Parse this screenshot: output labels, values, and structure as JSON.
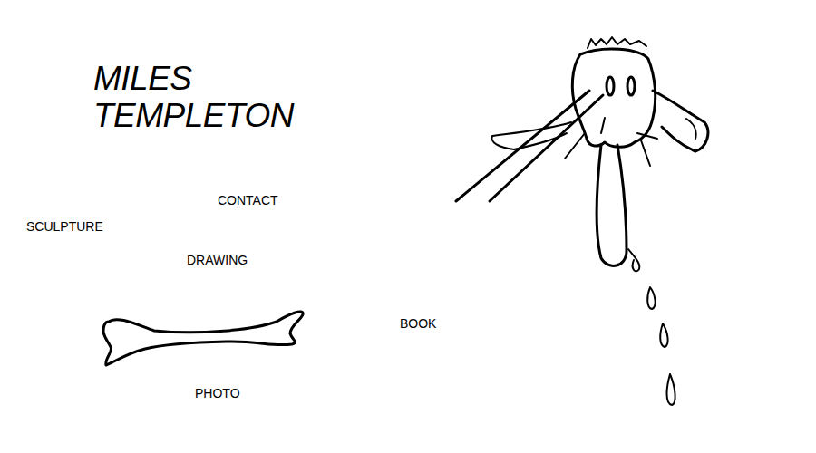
{
  "site": {
    "title_lines": [
      "MILES",
      "TEMPLETON"
    ]
  },
  "nav": [
    {
      "label": "CONTACT"
    },
    {
      "label": "SCULPTURE"
    },
    {
      "label": "DRAWING"
    },
    {
      "label": "BOOK"
    },
    {
      "label": "PHOTO"
    }
  ]
}
